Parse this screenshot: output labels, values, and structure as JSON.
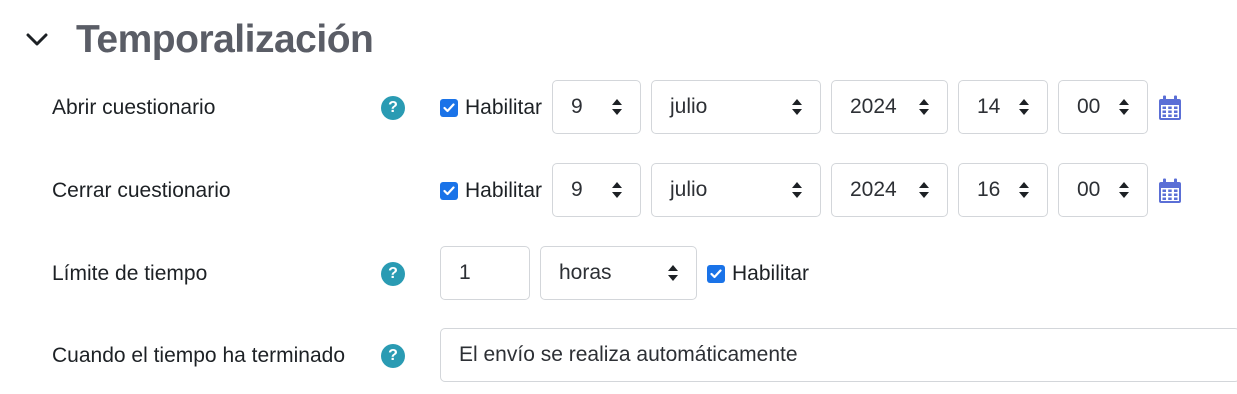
{
  "section": {
    "title": "Temporalización"
  },
  "open_quiz": {
    "label": "Abrir cuestionario",
    "enable_label": "Habilitar",
    "day": "9",
    "month": "julio",
    "year": "2024",
    "hour": "14",
    "minute": "00"
  },
  "close_quiz": {
    "label": "Cerrar cuestionario",
    "enable_label": "Habilitar",
    "day": "9",
    "month": "julio",
    "year": "2024",
    "hour": "16",
    "minute": "00"
  },
  "time_limit": {
    "label": "Límite de tiempo",
    "value": "1",
    "unit": "horas",
    "enable_label": "Habilitar"
  },
  "when_time_expires": {
    "label": "Cuando el tiempo ha terminado",
    "value": "El envío se realiza automáticamente"
  },
  "help_glyph": "?",
  "icons": {
    "collapse": "chevron-down-icon",
    "help": "help-icon",
    "calendar": "calendar-icon",
    "checkbox": "checkmark-icon"
  },
  "colors": {
    "title": "#5a5d66",
    "help": "#2a9bb3",
    "checkbox": "#1a73e8",
    "calendar": "#5b6fd6",
    "border": "#d3d6da"
  }
}
